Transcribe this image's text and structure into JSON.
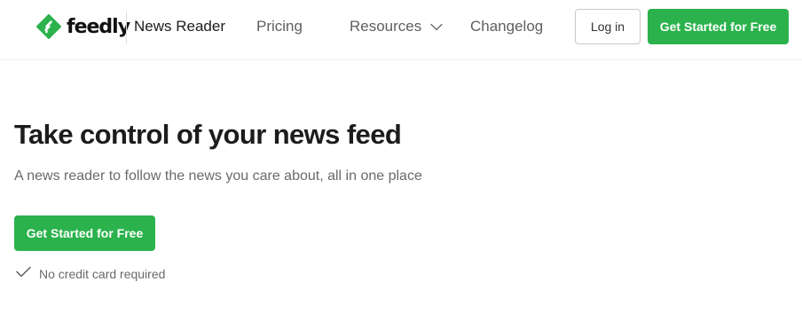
{
  "header": {
    "logo_text": "feedly",
    "product_name": "News Reader",
    "nav": {
      "pricing": "Pricing",
      "resources": "Resources",
      "changelog": "Changelog"
    },
    "login_label": "Log in",
    "cta_label": "Get Started for Free"
  },
  "hero": {
    "title": "Take control of your news feed",
    "subtitle": "A news reader to follow the news you care about, all in one place",
    "cta_label": "Get Started for Free",
    "note": "No credit card required"
  },
  "colors": {
    "brand_green": "#2bb24c",
    "text_dark": "#1c1c1c",
    "text_muted": "#6a6a6a"
  },
  "icons": {
    "logo": "feedly-logo-icon",
    "resources_dropdown": "chevron-down-icon",
    "note": "checkmark-icon"
  }
}
